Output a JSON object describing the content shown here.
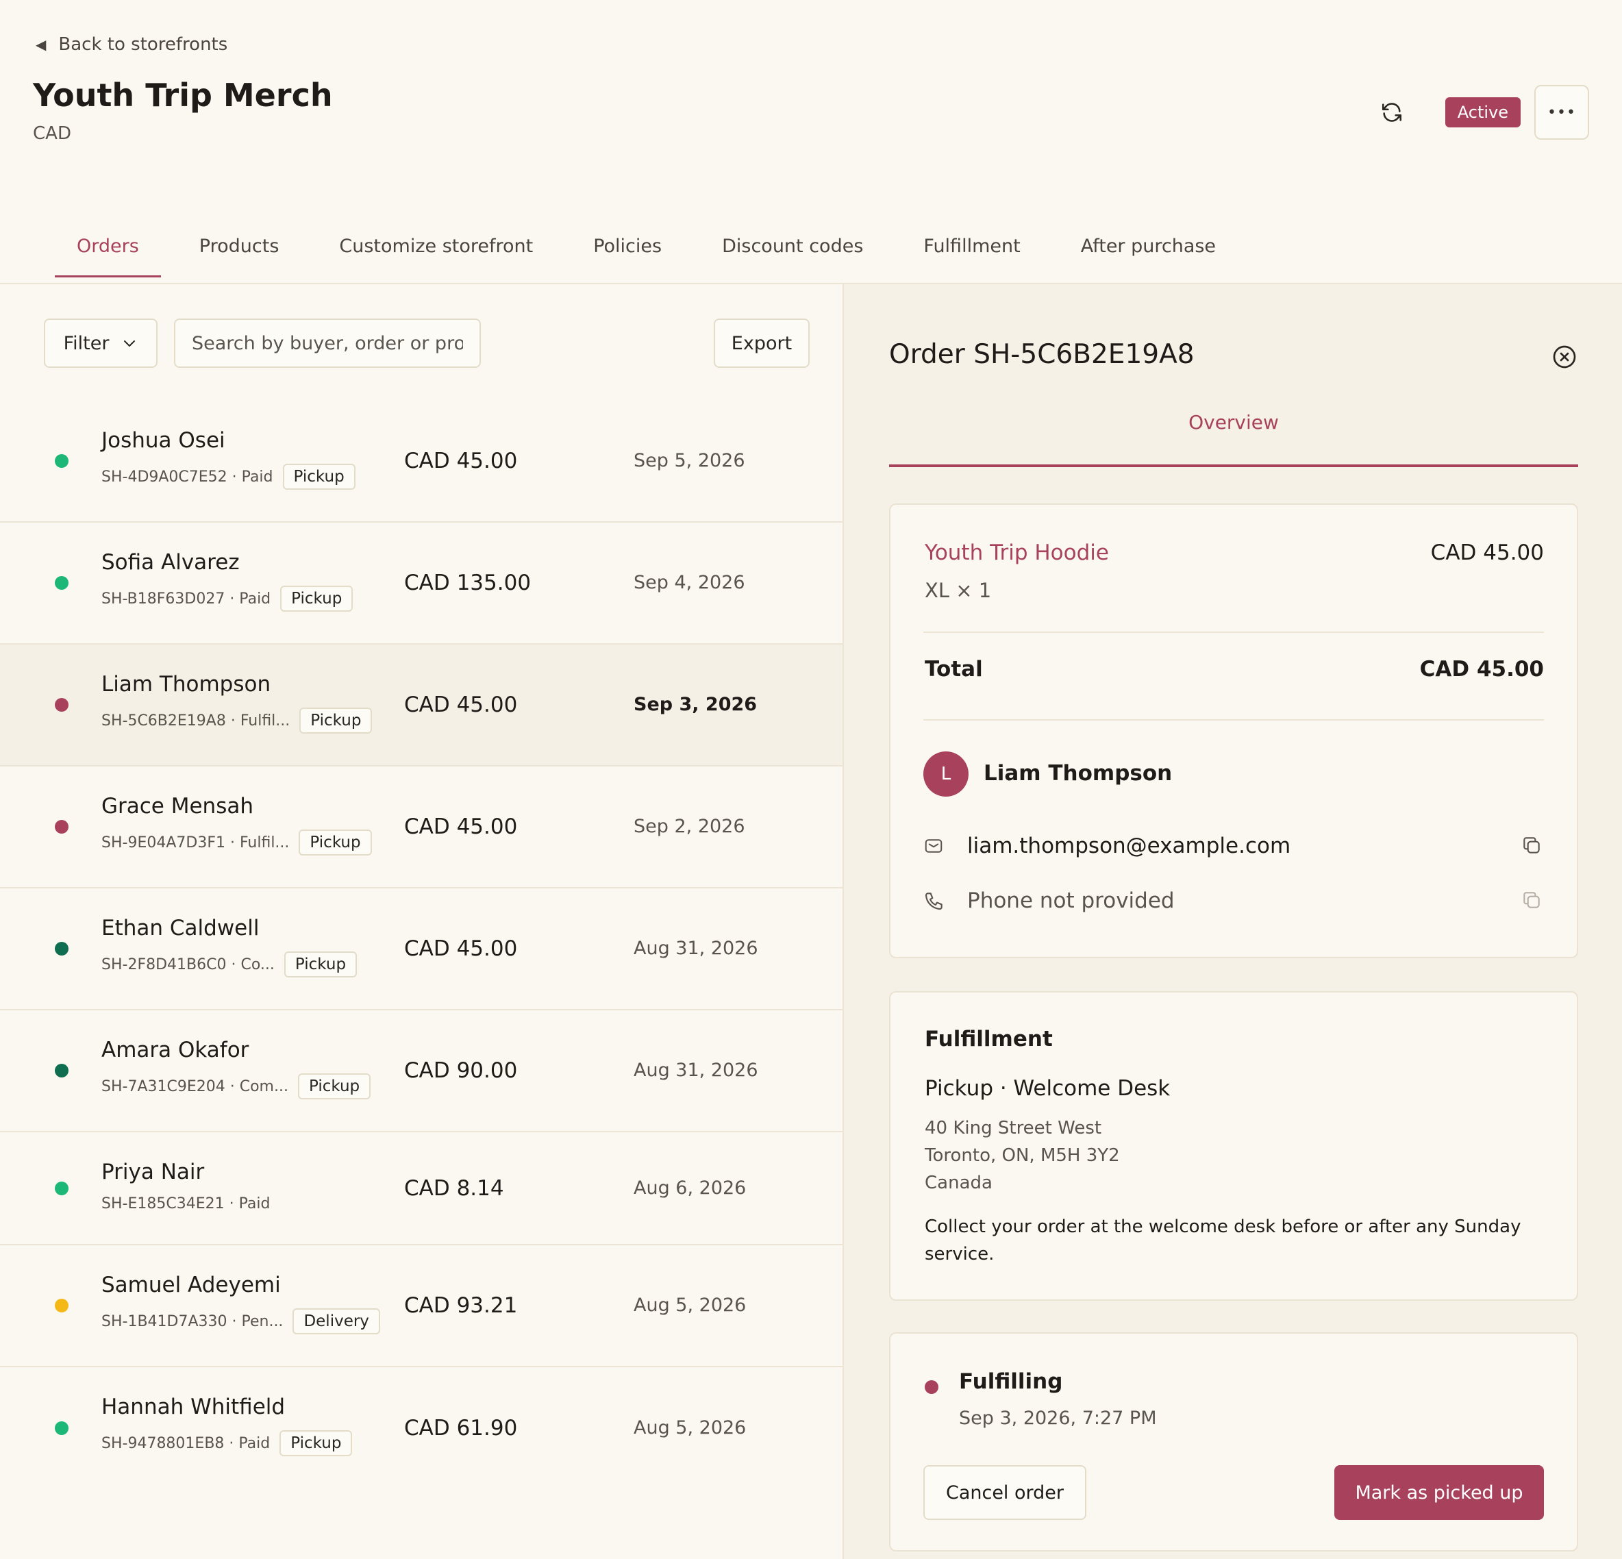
{
  "header": {
    "back_label": "Back to storefronts",
    "title": "Youth Trip Merch",
    "currency": "CAD",
    "status": "Active",
    "more_label": "•••"
  },
  "tabs": [
    {
      "label": "Orders",
      "active": true
    },
    {
      "label": "Products"
    },
    {
      "label": "Customize storefront"
    },
    {
      "label": "Policies"
    },
    {
      "label": "Discount codes"
    },
    {
      "label": "Fulfillment"
    },
    {
      "label": "After purchase"
    }
  ],
  "toolbar": {
    "filter_label": "Filter",
    "search_placeholder": "Search by buyer, order or prod",
    "export_label": "Export"
  },
  "orders": [
    {
      "name": "Joshua Osei",
      "meta": "SH-4D9A0C7E52 · Paid",
      "method": "Pickup",
      "amount": "CAD 45.00",
      "date": "Sep 5, 2026",
      "dot_color": "#1db877"
    },
    {
      "name": "Sofia Alvarez",
      "meta": "SH-B18F63D027 · Paid",
      "method": "Pickup",
      "amount": "CAD 135.00",
      "date": "Sep 4, 2026",
      "dot_color": "#1db877"
    },
    {
      "name": "Liam Thompson",
      "meta": "SH-5C6B2E19A8 · Fulfil...",
      "method": "Pickup",
      "amount": "CAD 45.00",
      "date": "Sep 3, 2026",
      "dot_color": "#a8425c",
      "selected": true
    },
    {
      "name": "Grace Mensah",
      "meta": "SH-9E04A7D3F1 · Fulfil...",
      "method": "Pickup",
      "amount": "CAD 45.00",
      "date": "Sep 2, 2026",
      "dot_color": "#a8425c"
    },
    {
      "name": "Ethan Caldwell",
      "meta": "SH-2F8D41B6C0 · Co...",
      "method": "Pickup",
      "amount": "CAD 45.00",
      "date": "Aug 31, 2026",
      "dot_color": "#0f6e4f"
    },
    {
      "name": "Amara Okafor",
      "meta": "SH-7A31C9E204 · Com...",
      "method": "Pickup",
      "amount": "CAD 90.00",
      "date": "Aug 31, 2026",
      "dot_color": "#0f6e4f"
    },
    {
      "name": "Priya Nair",
      "meta": "SH-E185C34E21 · Paid",
      "method": "",
      "amount": "CAD 8.14",
      "date": "Aug 6, 2026",
      "dot_color": "#1db877"
    },
    {
      "name": "Samuel Adeyemi",
      "meta": "SH-1B41D7A330 · Pen...",
      "method": "Delivery",
      "amount": "CAD 93.21",
      "date": "Aug 5, 2026",
      "dot_color": "#f5b819"
    },
    {
      "name": "Hannah Whitfield",
      "meta": "SH-9478801EB8 · Paid",
      "method": "Pickup",
      "amount": "CAD 61.90",
      "date": "Aug 5, 2026",
      "dot_color": "#1db877"
    }
  ],
  "detail": {
    "title": "Order SH-5C6B2E19A8",
    "tab": "Overview",
    "item": {
      "name": "Youth Trip Hoodie",
      "price": "CAD 45.00",
      "variant": "XL × 1"
    },
    "total_label": "Total",
    "total_value": "CAD 45.00",
    "buyer": {
      "initial": "L",
      "name": "Liam Thompson",
      "email": "liam.thompson@example.com",
      "phone": "Phone not provided"
    },
    "fulfillment": {
      "title": "Fulfillment",
      "pickup": "Pickup · Welcome Desk",
      "address_line1": "40 King Street West",
      "address_line2": "Toronto, ON, M5H 3Y2",
      "address_line3": "Canada",
      "note": "Collect your order at the welcome desk before or after any Sunday service."
    },
    "status": {
      "label": "Fulfilling",
      "time": "Sep 3, 2026, 7:27 PM"
    },
    "cancel_label": "Cancel order",
    "primary_label": "Mark as picked up"
  },
  "colors": {
    "accent": "#a8425c",
    "paid": "#1db877",
    "complete": "#0f6e4f",
    "pending": "#f5b819"
  }
}
